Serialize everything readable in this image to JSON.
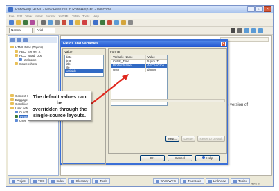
{
  "window": {
    "title": "RoboHelp HTML - New Features in RoboHelp X6 - Welcome",
    "menu": [
      "File",
      "Edit",
      "View",
      "Insert",
      "Format",
      "XHTML",
      "Table",
      "Tools",
      "Help"
    ]
  },
  "toolbar": {
    "style_value": "Normal",
    "font_value": "Arial"
  },
  "project_tree": {
    "items": [
      {
        "label": "HTML Files (Topics)",
        "indent": 0,
        "icon": "folder"
      },
      {
        "label": "ABC_Server_X",
        "indent": 1,
        "icon": "folder"
      },
      {
        "label": "FCC_Word_Doc",
        "indent": 1,
        "icon": "folder"
      },
      {
        "label": "Welcome",
        "indent": 2,
        "icon": "page"
      },
      {
        "label": "Screenshots",
        "indent": 1,
        "icon": "folder"
      },
      {
        "label": "Context-Sensitive",
        "indent": 0,
        "icon": "folder"
      },
      {
        "label": "Baggage Files",
        "indent": 0,
        "icon": "folder"
      },
      {
        "label": "Conditional Build T",
        "indent": 0,
        "icon": "folder"
      },
      {
        "label": "User defined Vari",
        "indent": 0,
        "icon": "folder"
      },
      {
        "label": "Cutoff_Time",
        "indent": 1,
        "icon": "page"
      },
      {
        "label": "ProductName",
        "indent": 1,
        "icon": "sel",
        "selected": true
      },
      {
        "label": "User",
        "indent": 1,
        "icon": "page"
      }
    ]
  },
  "editor": {
    "partial_text": "is version of"
  },
  "bottom_tabs": [
    "Project",
    "TOC",
    "Index",
    "Glossary",
    "Tools"
  ],
  "bottom_right_tabs": [
    "WYSIWYG",
    "TrueCode",
    "Link View",
    "Topics"
  ],
  "status_label": "TITLE",
  "dialog": {
    "title": "Fields and Variables",
    "close_glyph": "x",
    "value_group_label": "Value",
    "values": [
      {
        "label": "date",
        "selected": false
      },
      {
        "label": "time",
        "selected": false
      },
      {
        "label": "title",
        "selected": false
      },
      {
        "label": "file",
        "selected": false
      },
      {
        "label": "variable",
        "selected": true
      }
    ],
    "format_group_label": "Format",
    "table_headers": [
      "Variable Name",
      "Value"
    ],
    "rows": [
      {
        "name": "Cutoff_Time",
        "value": "5 p.m. T",
        "selected": false
      },
      {
        "name": "ProductName",
        "value": "ABC HiGrne",
        "selected": true
      },
      {
        "name": "User",
        "value": "doctor",
        "selected": false
      }
    ],
    "buttons": {
      "new": "New...",
      "delete": "Delete",
      "reset": "Reset to Default",
      "ok": "OK",
      "cancel": "Cancel",
      "help": "Help"
    }
  },
  "callout": {
    "line1": "The default values can be",
    "line2": "overridden through the",
    "line3": "single-source layouts.",
    "arrow_color": "#e0281e"
  }
}
